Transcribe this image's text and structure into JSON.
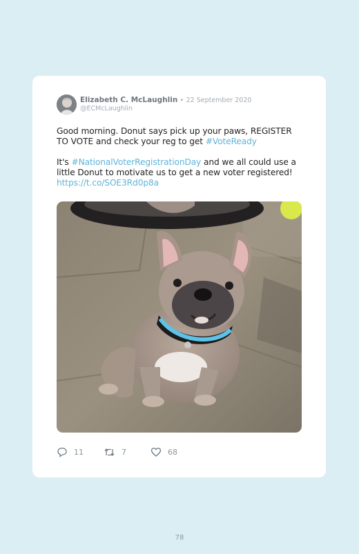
{
  "tweet": {
    "author_name": "Elizabeth C. McLaughlin",
    "separator": "•",
    "date": "22 September 2020",
    "handle": "@ECMcLaughlin",
    "para1_text": "Good morning. Donut says pick up your paws, REGISTER TO VOTE and check your reg to get ",
    "para1_hashtag": "#VoteReady",
    "para2_pre": "It's ",
    "para2_hashtag": "#NationalVoterRegistrationDay",
    "para2_text": " and we all could use a little Donut to motivate us to get a new voter registered! ",
    "para2_link": "https://t.co/SOE3Rd0p8a",
    "photo_icon": "puppy-photo",
    "replies": "11",
    "retweets": "7",
    "likes": "68"
  },
  "page_number": "78",
  "colors": {
    "background": "#dbeef4",
    "card": "#ffffff",
    "link": "#5eb3d9",
    "meta_text": "#a3acb3"
  }
}
